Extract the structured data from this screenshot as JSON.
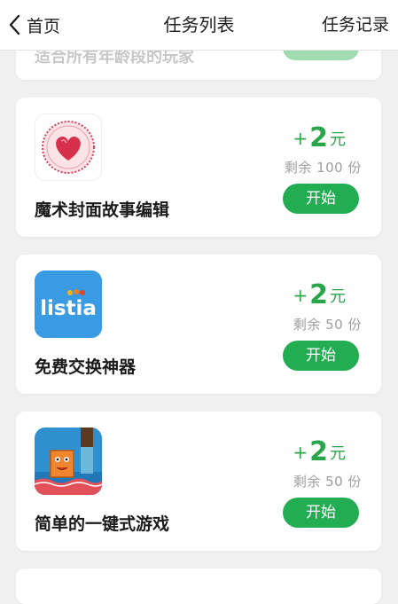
{
  "nav": {
    "back_label": "首页",
    "title": "任务列表",
    "right_label": "任务记录"
  },
  "partial_card": {
    "text": "适合所有年龄段的玩家"
  },
  "tasks": [
    {
      "name": "魔术封面故事编辑",
      "icon": "heart-stamp-icon",
      "reward_plus": "+",
      "reward_amount": "2",
      "reward_unit": "元",
      "remain": "剩余 100 份",
      "button": "开始"
    },
    {
      "name": "免费交换神器",
      "icon": "listia-logo-icon",
      "icon_text": "listia",
      "reward_plus": "+",
      "reward_amount": "2",
      "reward_unit": "元",
      "remain": "剩余 50 份",
      "button": "开始"
    },
    {
      "name": "简单的一键式游戏",
      "icon": "block-character-game-icon",
      "reward_plus": "+",
      "reward_amount": "2",
      "reward_unit": "元",
      "remain": "剩余 50 份",
      "button": "开始"
    }
  ],
  "colors": {
    "accent_green": "#23ad52",
    "reward_green": "#2ba54a",
    "page_bg": "#f0f0f0"
  }
}
